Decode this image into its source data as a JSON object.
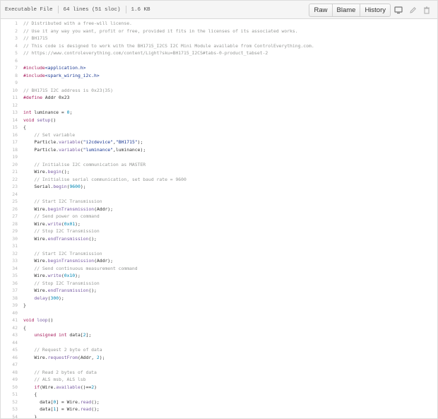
{
  "header": {
    "mode": "Executable File",
    "lines": "64 lines (51 sloc)",
    "size": "1.6 KB",
    "buttons": {
      "raw": "Raw",
      "blame": "Blame",
      "history": "History"
    }
  },
  "code": [
    [
      {
        "t": "// Distributed with a free-will license.",
        "c": "c"
      }
    ],
    [
      {
        "t": "// Use it any way you want, profit or free, provided it fits in the licenses of its associated works.",
        "c": "c"
      }
    ],
    [
      {
        "t": "// BH1715",
        "c": "c"
      }
    ],
    [
      {
        "t": "// This code is designed to work with the BH1715_I2CS I2C Mini Module available from ControlEverything.com.",
        "c": "c"
      }
    ],
    [
      {
        "t": "// https://www.controleverything.com/content/Light?sku=BH1715_I2CS#tabs-0-product_tabset-2",
        "c": "c"
      }
    ],
    [],
    [
      {
        "t": "#include",
        "c": "k"
      },
      {
        "t": "<application.h>",
        "c": "s"
      }
    ],
    [
      {
        "t": "#include",
        "c": "k"
      },
      {
        "t": "<spark_wiring_i2c.h>",
        "c": "s"
      }
    ],
    [],
    [
      {
        "t": "// BH1715 I2C address is 0x23(35)",
        "c": "c"
      }
    ],
    [
      {
        "t": "#define",
        "c": "k"
      },
      {
        "t": " Addr 0x23",
        "c": "m"
      }
    ],
    [],
    [
      {
        "t": "int",
        "c": "k"
      },
      {
        "t": " luminance = ",
        "c": "m"
      },
      {
        "t": "0",
        "c": "n"
      },
      {
        "t": ";",
        "c": "m"
      }
    ],
    [
      {
        "t": "void",
        "c": "k"
      },
      {
        "t": " ",
        "c": "m"
      },
      {
        "t": "setup",
        "c": "f"
      },
      {
        "t": "()",
        "c": "m"
      }
    ],
    [
      {
        "t": "{",
        "c": "m"
      }
    ],
    [
      {
        "t": "    // Set variable",
        "c": "c"
      }
    ],
    [
      {
        "t": "    Particle.",
        "c": "m"
      },
      {
        "t": "variable",
        "c": "f"
      },
      {
        "t": "(",
        "c": "m"
      },
      {
        "t": "\"i2cdevice\"",
        "c": "s"
      },
      {
        "t": ",",
        "c": "m"
      },
      {
        "t": "\"BH1715\"",
        "c": "s"
      },
      {
        "t": ");",
        "c": "m"
      }
    ],
    [
      {
        "t": "    Particle.",
        "c": "m"
      },
      {
        "t": "variable",
        "c": "f"
      },
      {
        "t": "(",
        "c": "m"
      },
      {
        "t": "\"luminance\"",
        "c": "s"
      },
      {
        "t": ",luminance);",
        "c": "m"
      }
    ],
    [],
    [
      {
        "t": "    // Initialise I2C communication as MASTER",
        "c": "c"
      }
    ],
    [
      {
        "t": "    Wire.",
        "c": "m"
      },
      {
        "t": "begin",
        "c": "f"
      },
      {
        "t": "();",
        "c": "m"
      }
    ],
    [
      {
        "t": "    // Initialise serial communication, set baud rate = 9600",
        "c": "c"
      }
    ],
    [
      {
        "t": "    Serial.",
        "c": "m"
      },
      {
        "t": "begin",
        "c": "f"
      },
      {
        "t": "(",
        "c": "m"
      },
      {
        "t": "9600",
        "c": "n"
      },
      {
        "t": ");",
        "c": "m"
      }
    ],
    [],
    [
      {
        "t": "    // Start I2C Transmission",
        "c": "c"
      }
    ],
    [
      {
        "t": "    Wire.",
        "c": "m"
      },
      {
        "t": "beginTransmission",
        "c": "f"
      },
      {
        "t": "(Addr);",
        "c": "m"
      }
    ],
    [
      {
        "t": "    // Send power on command",
        "c": "c"
      }
    ],
    [
      {
        "t": "    Wire.",
        "c": "m"
      },
      {
        "t": "write",
        "c": "f"
      },
      {
        "t": "(",
        "c": "m"
      },
      {
        "t": "0x01",
        "c": "n"
      },
      {
        "t": ");",
        "c": "m"
      }
    ],
    [
      {
        "t": "    // Stop I2C Transmission",
        "c": "c"
      }
    ],
    [
      {
        "t": "    Wire.",
        "c": "m"
      },
      {
        "t": "endTransmission",
        "c": "f"
      },
      {
        "t": "();",
        "c": "m"
      }
    ],
    [],
    [
      {
        "t": "    // Start I2C Transmission",
        "c": "c"
      }
    ],
    [
      {
        "t": "    Wire.",
        "c": "m"
      },
      {
        "t": "beginTransmission",
        "c": "f"
      },
      {
        "t": "(Addr);",
        "c": "m"
      }
    ],
    [
      {
        "t": "    // Send continuous measurement command",
        "c": "c"
      }
    ],
    [
      {
        "t": "    Wire.",
        "c": "m"
      },
      {
        "t": "write",
        "c": "f"
      },
      {
        "t": "(",
        "c": "m"
      },
      {
        "t": "0x10",
        "c": "n"
      },
      {
        "t": ");",
        "c": "m"
      }
    ],
    [
      {
        "t": "    // Stop I2C Transmission",
        "c": "c"
      }
    ],
    [
      {
        "t": "    Wire.",
        "c": "m"
      },
      {
        "t": "endTransmission",
        "c": "f"
      },
      {
        "t": "();",
        "c": "m"
      }
    ],
    [
      {
        "t": "    ",
        "c": "m"
      },
      {
        "t": "delay",
        "c": "f"
      },
      {
        "t": "(",
        "c": "m"
      },
      {
        "t": "300",
        "c": "n"
      },
      {
        "t": ");",
        "c": "m"
      }
    ],
    [
      {
        "t": "}",
        "c": "m"
      }
    ],
    [],
    [
      {
        "t": "void",
        "c": "k"
      },
      {
        "t": " ",
        "c": "m"
      },
      {
        "t": "loop",
        "c": "f"
      },
      {
        "t": "()",
        "c": "m"
      }
    ],
    [
      {
        "t": "{",
        "c": "m"
      }
    ],
    [
      {
        "t": "    ",
        "c": "m"
      },
      {
        "t": "unsigned int",
        "c": "k"
      },
      {
        "t": " data[",
        "c": "m"
      },
      {
        "t": "2",
        "c": "n"
      },
      {
        "t": "];",
        "c": "m"
      }
    ],
    [],
    [
      {
        "t": "    // Request 2 byte of data",
        "c": "c"
      }
    ],
    [
      {
        "t": "    Wire.",
        "c": "m"
      },
      {
        "t": "requestFrom",
        "c": "f"
      },
      {
        "t": "(Addr, ",
        "c": "m"
      },
      {
        "t": "2",
        "c": "n"
      },
      {
        "t": ");",
        "c": "m"
      }
    ],
    [],
    [
      {
        "t": "    // Read 2 bytes of data",
        "c": "c"
      }
    ],
    [
      {
        "t": "    // ALS msb, ALS lsb",
        "c": "c"
      }
    ],
    [
      {
        "t": "    ",
        "c": "m"
      },
      {
        "t": "if",
        "c": "k"
      },
      {
        "t": "(Wire.",
        "c": "m"
      },
      {
        "t": "available",
        "c": "f"
      },
      {
        "t": "()==",
        "c": "m"
      },
      {
        "t": "2",
        "c": "n"
      },
      {
        "t": ")",
        "c": "m"
      }
    ],
    [
      {
        "t": "    {",
        "c": "m"
      }
    ],
    [
      {
        "t": "      data[",
        "c": "m"
      },
      {
        "t": "0",
        "c": "n"
      },
      {
        "t": "] = Wire.",
        "c": "m"
      },
      {
        "t": "read",
        "c": "f"
      },
      {
        "t": "();",
        "c": "m"
      }
    ],
    [
      {
        "t": "      data[",
        "c": "m"
      },
      {
        "t": "1",
        "c": "n"
      },
      {
        "t": "] = Wire.",
        "c": "m"
      },
      {
        "t": "read",
        "c": "f"
      },
      {
        "t": "();",
        "c": "m"
      }
    ],
    [
      {
        "t": "    }",
        "c": "m"
      }
    ]
  ]
}
